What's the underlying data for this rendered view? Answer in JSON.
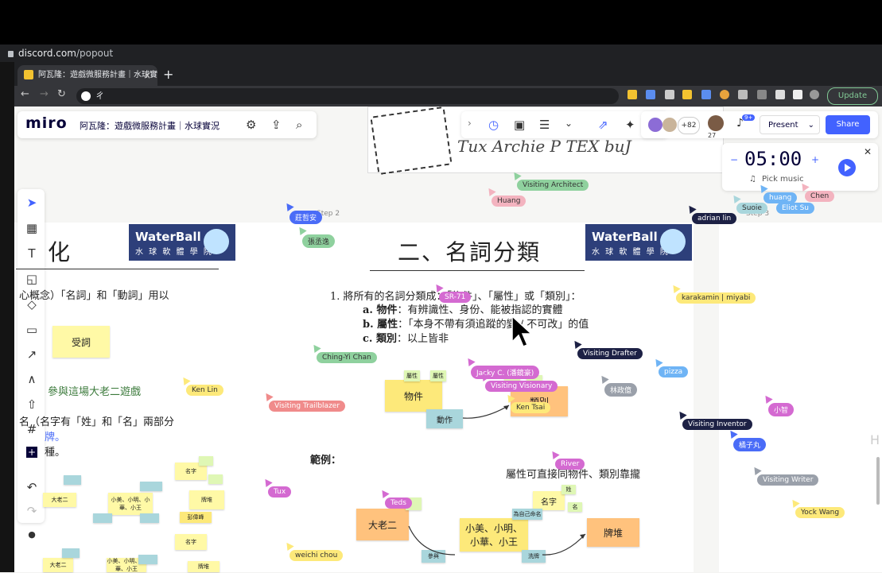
{
  "browser": {
    "popout_host": "discord.com",
    "popout_path": "/popout",
    "tab_title": "阿瓦隆：遊戲微服務計畫｜水球實況",
    "tab_close": "×",
    "new_tab": "+",
    "address_text": "ㄔ",
    "update_label": "Update"
  },
  "miro": {
    "logo": "miro",
    "board_name": "阿瓦隆：遊戲微服務計畫｜水球實況",
    "participants_extra": "+82",
    "followers_count": "27",
    "present_label": "Present",
    "share_label": "Share",
    "notification_badge": "9+",
    "timer": {
      "minutes": "05",
      "sep": ":",
      "seconds": "00",
      "pick_music": "Pick music",
      "minus": "−",
      "plus": "+"
    }
  },
  "board": {
    "logo_title": "WaterBall",
    "logo_subtitle": "水 球 軟 體 學 院",
    "left_heading": "化",
    "left_line1": "心概念）「名詞」和「動詞」用以",
    "left_line2": "參與這場大老二遊戲",
    "left_line3": "名（名字有「姓」和「名」兩部分",
    "left_line4": "牌。",
    "left_line5": "種。",
    "left_sticky": "受詞",
    "left_small1": "大老二",
    "left_small2": "小美、小明、小華、小王",
    "left_small3": "名字",
    "left_small4": "牌堆",
    "left_small5": "彭偉峰",
    "step2": "Step 2",
    "step3": "Step 3",
    "main_heading": "二、名詞分類",
    "line1": "1. 將所有的名詞分類成：「物件」、「屬性」或「類別」：",
    "line_a_label": "a. 物件",
    "line_a_text": "：有辨識性、身份、能被指認的實體",
    "line_b_label": "b. 屬性",
    "line_b_text": "：「本身不帶有須追蹤的變 / 不可改」的值",
    "line_c_label": "c. 類別",
    "line_c_text": "：以上皆非",
    "sticky_object": "物件",
    "sticky_class": "類別",
    "sticky_action": "動作",
    "sticky_attr1": "屬性",
    "sticky_attr2": "屬性",
    "example_label": "範例：",
    "example_note": "屬性可直接同物件、類別靠攏",
    "ex_bigtwo": "大老二",
    "ex_players": "小美、小明、\n小華、小王",
    "ex_deck": "牌堆",
    "ex_name": "名字",
    "ex_attend": "參與",
    "ex_shuffle": "洗牌",
    "ex_small1": "姓",
    "ex_small2": "名",
    "ex_small3": "為自己命名",
    "scribble_text": "Tux Archie P   TEX buJ"
  },
  "cursors": [
    {
      "name": "Visiting Architect",
      "color": "#8fd19e"
    },
    {
      "name": "Huang",
      "color": "#f3b3bf"
    },
    {
      "name": "莊哲安",
      "color": "#4a6cf7"
    },
    {
      "name": "張丞逸",
      "color": "#8fd19e"
    },
    {
      "name": "SR-71",
      "color": "#d46ad1"
    },
    {
      "name": "Ching-Yi Chan",
      "color": "#8fd19e"
    },
    {
      "name": "Jacky C. (潘鏡豪)",
      "color": "#d46ad1"
    },
    {
      "name": "Visiting Visionary",
      "color": "#d46ad1"
    },
    {
      "name": "Ken Tsai",
      "color": "#fde97a"
    },
    {
      "name": "Visiting Drafter",
      "color": "#1d2145"
    },
    {
      "name": "林政億",
      "color": "#9aa0aa"
    },
    {
      "name": "pizza",
      "color": "#6fb4f5"
    },
    {
      "name": "karakamin | miyabi",
      "color": "#fde97a"
    },
    {
      "name": "Visiting Trailblazer",
      "color": "#f08b8b"
    },
    {
      "name": "Ken Lin",
      "color": "#fde97a"
    },
    {
      "name": "Visiting Inventor",
      "color": "#1d2145"
    },
    {
      "name": "橘子丸",
      "color": "#4a6cf7"
    },
    {
      "name": "小智",
      "color": "#d46ad1"
    },
    {
      "name": "Visiting Writer",
      "color": "#9aa0aa"
    },
    {
      "name": "Yock Wang",
      "color": "#fde97a"
    },
    {
      "name": "Tux",
      "color": "#d46ad1"
    },
    {
      "name": "Teds",
      "color": "#d46ad1"
    },
    {
      "name": "River",
      "color": "#d46ad1"
    },
    {
      "name": "weichi chou",
      "color": "#fde97a"
    },
    {
      "name": "adrian lin",
      "color": "#1d2145"
    },
    {
      "name": "Suoie",
      "color": "#a9d6dc"
    },
    {
      "name": "Eliot Su",
      "color": "#6fb4f5"
    },
    {
      "name": "huang",
      "color": "#6fb4f5"
    },
    {
      "name": "Chen",
      "color": "#f3b3bf"
    }
  ]
}
